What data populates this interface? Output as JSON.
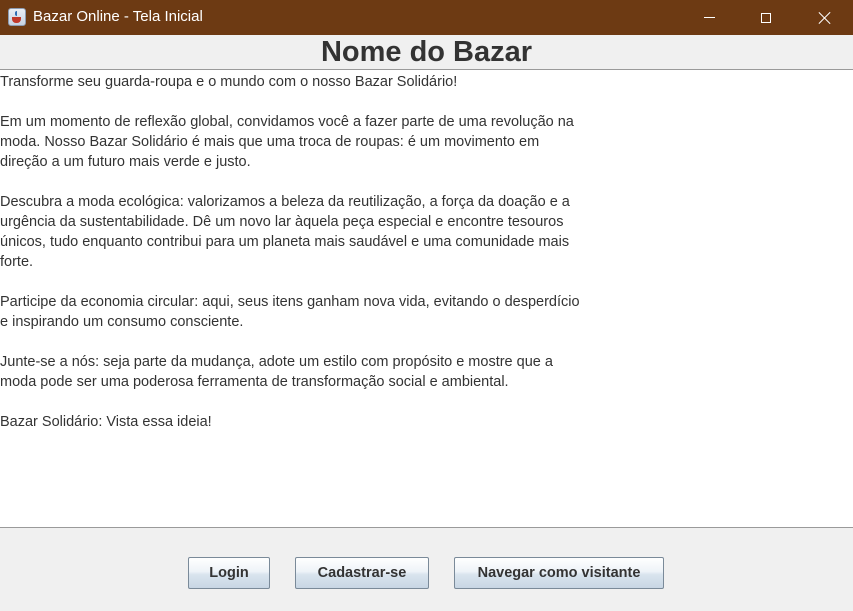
{
  "window": {
    "title": "Bazar Online - Tela Inicial",
    "icon": "java-cup-icon",
    "title_bar_color": "#6d3a13"
  },
  "header": {
    "title": "Nome do Bazar"
  },
  "content": {
    "text": "Transforme seu guarda-roupa e o mundo com o nosso Bazar Solidário!\n\nEm um momento de reflexão global, convidamos você a fazer parte de uma revolução na\nmoda. Nosso Bazar Solidário é mais que uma troca de roupas: é um movimento em\ndireção a um futuro mais verde e justo.\n\nDescubra a moda ecológica: valorizamos a beleza da reutilização, a força da doação e a\nurgência da sustentabilidade. Dê um novo lar àquela peça especial e encontre tesouros\núnicos, tudo enquanto contribui para um planeta mais saudável e uma comunidade mais\nforte.\n\nParticipe da economia circular: aqui, seus itens ganham nova vida, evitando o desperdício\ne inspirando um consumo consciente.\n\nJunte-se a nós: seja parte da mudança, adote um estilo com propósito e mostre que a\nmoda pode ser uma poderosa ferramenta de transformação social e ambiental.\n\nBazar Solidário: Vista essa ideia!"
  },
  "buttons": {
    "login": "Login",
    "signup": "Cadastrar-se",
    "guest": "Navegar como visitante"
  }
}
